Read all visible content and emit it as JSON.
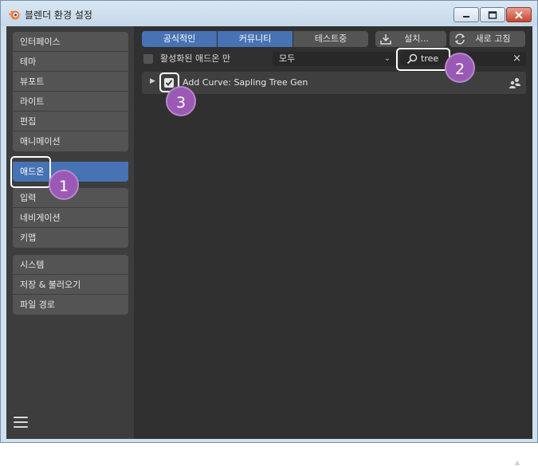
{
  "window": {
    "title": "블렌더 환경 설정",
    "icon": "blender-logo-icon",
    "controls": [
      "minimize-icon",
      "maximize-icon",
      "close-icon"
    ]
  },
  "sidebar": {
    "groups": [
      {
        "items": [
          "인터페이스",
          "테마",
          "뷰포트",
          "라이트",
          "편집",
          "애니메이션"
        ]
      },
      {
        "items": [
          "애드온"
        ],
        "active": "애드온"
      },
      {
        "items": [
          "입력",
          "네비게이션",
          "키맵"
        ]
      },
      {
        "items": [
          "시스템",
          "저장 & 불러오기",
          "파일 경로"
        ]
      }
    ],
    "menu_icon": "hamburger-menu-icon"
  },
  "toolbar": {
    "tabs": [
      {
        "label": "공식적인",
        "active": true
      },
      {
        "label": "커뮤니티",
        "active": true
      },
      {
        "label": "테스트중",
        "active": false
      }
    ],
    "install_label": "설치...",
    "install_icon": "download-icon",
    "refresh_label": "새로 고침",
    "refresh_icon": "refresh-icon"
  },
  "filters": {
    "enabled_only_label": "활성화된 애드온 만",
    "enabled_only_checked": false,
    "category_value": "모두",
    "search_value": "tree",
    "search_icon": "magnifier-icon",
    "clear_icon": "clear-x-icon"
  },
  "addons": [
    {
      "name": "Add Curve: Sapling Tree Gen",
      "enabled": true,
      "support_icon": "community-icon"
    }
  ],
  "annotations": [
    "1",
    "2",
    "3"
  ],
  "colors": {
    "accent": "#4772b3",
    "panel": "#3d3d3d",
    "content": "#303030",
    "widget": "#545454",
    "badge": "#9b59b6"
  }
}
